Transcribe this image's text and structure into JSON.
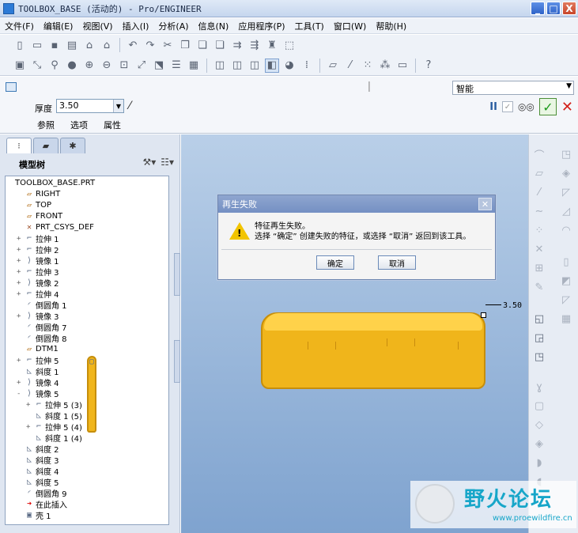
{
  "window": {
    "title": "TOOLBOX_BASE (活动的) - Pro/ENGINEER",
    "minimize": "_",
    "maximize": "□",
    "close": "X"
  },
  "menu": [
    "文件(F)",
    "编辑(E)",
    "视图(V)",
    "插入(I)",
    "分析(A)",
    "信息(N)",
    "应用程序(P)",
    "工具(T)",
    "窗口(W)",
    "帮助(H)"
  ],
  "dashboard": {
    "thickness_label": "厚度",
    "thickness_value": "3.50",
    "filter_value": "智能",
    "tabs": [
      "参照",
      "选项",
      "属性"
    ],
    "pause": "II",
    "preview_check": "✓",
    "glasses": "◎◎",
    "ok": "✓",
    "cancel": "✕"
  },
  "model_tree": {
    "title": "模型树",
    "items": [
      {
        "label": "TOOLBOX_BASE.PRT",
        "icon": "part",
        "indent": 0,
        "expander": ""
      },
      {
        "label": "RIGHT",
        "icon": "plane",
        "indent": 1,
        "expander": ""
      },
      {
        "label": "TOP",
        "icon": "plane",
        "indent": 1,
        "expander": ""
      },
      {
        "label": "FRONT",
        "icon": "plane",
        "indent": 1,
        "expander": ""
      },
      {
        "label": "PRT_CSYS_DEF",
        "icon": "csys",
        "indent": 1,
        "expander": ""
      },
      {
        "label": "拉伸 1",
        "icon": "extrude",
        "indent": 1,
        "expander": "+"
      },
      {
        "label": "拉伸 2",
        "icon": "extrude",
        "indent": 1,
        "expander": "+"
      },
      {
        "label": "镜像 1",
        "icon": "mirror",
        "indent": 1,
        "expander": "+"
      },
      {
        "label": "拉伸 3",
        "icon": "extrude",
        "indent": 1,
        "expander": "+"
      },
      {
        "label": "镜像 2",
        "icon": "mirror",
        "indent": 1,
        "expander": "+"
      },
      {
        "label": "拉伸 4",
        "icon": "extrude",
        "indent": 1,
        "expander": "+"
      },
      {
        "label": "倒圆角 1",
        "icon": "round",
        "indent": 1,
        "expander": ""
      },
      {
        "label": "镜像 3",
        "icon": "mirror",
        "indent": 1,
        "expander": "+"
      },
      {
        "label": "倒圆角 7",
        "icon": "round",
        "indent": 1,
        "expander": ""
      },
      {
        "label": "倒圆角 8",
        "icon": "round",
        "indent": 1,
        "expander": ""
      },
      {
        "label": "DTM1",
        "icon": "plane",
        "indent": 1,
        "expander": ""
      },
      {
        "label": "拉伸 5",
        "icon": "extrude",
        "indent": 1,
        "expander": "+"
      },
      {
        "label": "斜度 1",
        "icon": "draft",
        "indent": 1,
        "expander": ""
      },
      {
        "label": "镜像 4",
        "icon": "mirror",
        "indent": 1,
        "expander": "+"
      },
      {
        "label": "镜像 5",
        "icon": "mirror",
        "indent": 1,
        "expander": "-"
      },
      {
        "label": "拉伸 5 (3)",
        "icon": "extrude",
        "indent": 2,
        "expander": "+"
      },
      {
        "label": "斜度 1 (5)",
        "icon": "draft",
        "indent": 2,
        "expander": ""
      },
      {
        "label": "拉伸 5 (4)",
        "icon": "extrude",
        "indent": 2,
        "expander": "+"
      },
      {
        "label": "斜度 1 (4)",
        "icon": "draft",
        "indent": 2,
        "expander": ""
      },
      {
        "label": "斜度 2",
        "icon": "draft",
        "indent": 1,
        "expander": ""
      },
      {
        "label": "斜度 3",
        "icon": "draft",
        "indent": 1,
        "expander": ""
      },
      {
        "label": "斜度 4",
        "icon": "draft",
        "indent": 1,
        "expander": ""
      },
      {
        "label": "斜度 5",
        "icon": "draft",
        "indent": 1,
        "expander": ""
      },
      {
        "label": "倒圆角 9",
        "icon": "round",
        "indent": 1,
        "expander": ""
      },
      {
        "label": "在此插入",
        "icon": "insert",
        "indent": 1,
        "expander": ""
      },
      {
        "label": "壳 1",
        "icon": "shell",
        "indent": 1,
        "expander": ""
      }
    ]
  },
  "graphics": {
    "dimension": "3.50"
  },
  "dialog": {
    "title": "再生失败",
    "message1": "特征再生失败。",
    "message2": "选择 “确定” 创建失败的特征，或选择 “取消” 返回到该工具。",
    "ok": "确定",
    "cancel": "取消",
    "close": "✕"
  },
  "watermark": {
    "text": "野火论坛",
    "url": "www.proewildfire.cn"
  },
  "colors": {
    "part": "#f0b51b",
    "background_top": "#b9cfe8",
    "background_bottom": "#7fa3cf",
    "ok_green": "#1c9a1c",
    "cancel_red": "#d3201a"
  }
}
